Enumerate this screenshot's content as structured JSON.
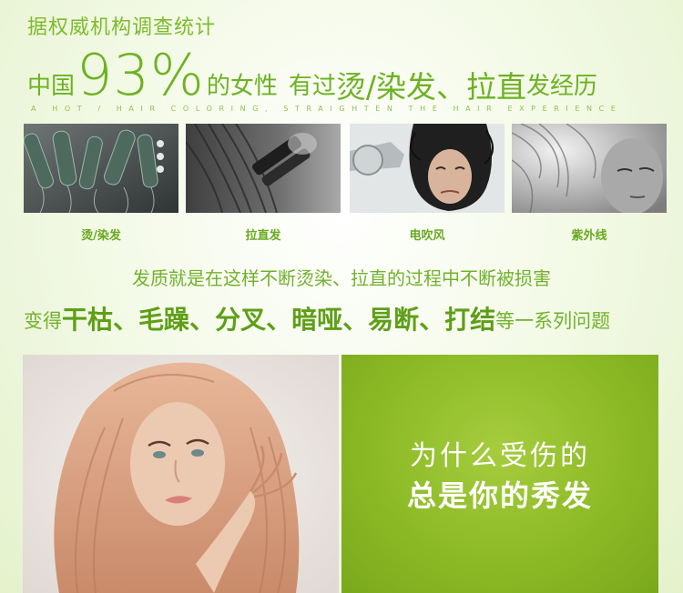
{
  "header": {
    "intro": "据权威机构调查统计",
    "prefix": "中国",
    "percent": "93%",
    "female": "的女性",
    "had": "有过",
    "perm_dye": "烫/染发",
    "comma": "、",
    "straighten": "拉直",
    "experience": "发经历",
    "subtitle": "A HOT / HAIR COLORING, STRAIGHTEN THE HAIR EXPERIENCE"
  },
  "photos": [
    {
      "icon": "hair-curlers-photo",
      "caption": "烫/染发"
    },
    {
      "icon": "hair-straightener-photo",
      "caption": "拉直发"
    },
    {
      "icon": "hair-dryer-photo",
      "caption": "电吹风"
    },
    {
      "icon": "sunlight-hair-photo",
      "caption": "紫外线"
    }
  ],
  "damage": {
    "line1": "发质就是在这样不断烫染、拉直的过程中不断被损害",
    "lead": "变得",
    "w1": "干枯",
    "w2": "毛躁",
    "w3": "分叉",
    "w4": "暗哑",
    "w5": "易断",
    "w6": "打结",
    "sep": "、",
    "tail": "等一系列问题"
  },
  "hero": {
    "icon": "woman-with-split-ends-photo"
  },
  "panel": {
    "line1": "为什么受伤的",
    "line2": "总是你的秀发"
  },
  "colors": {
    "accent": "#72b12b",
    "panel": "#8cba26"
  }
}
